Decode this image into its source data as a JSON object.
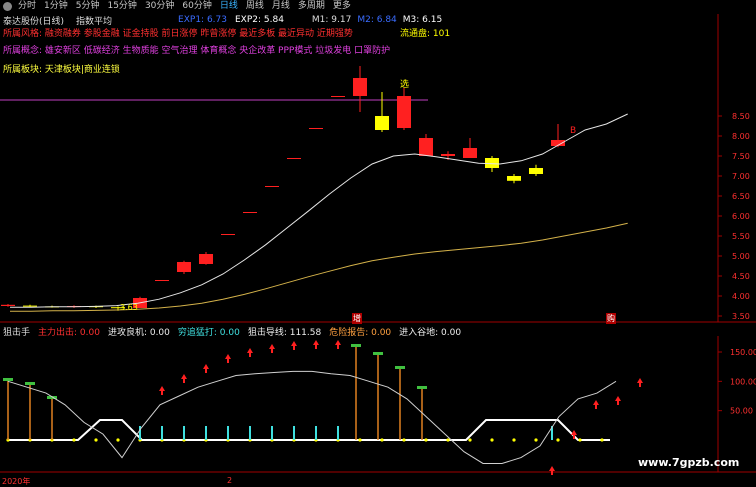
{
  "tabs": [
    {
      "label": "分时",
      "active": false
    },
    {
      "label": "1分钟",
      "active": false
    },
    {
      "label": "5分钟",
      "active": false
    },
    {
      "label": "15分钟",
      "active": false
    },
    {
      "label": "30分钟",
      "active": false
    },
    {
      "label": "60分钟",
      "active": false
    },
    {
      "label": "日线",
      "active": true
    },
    {
      "label": "周线",
      "active": false
    },
    {
      "label": "月线",
      "active": false
    },
    {
      "label": "多周期",
      "active": false
    },
    {
      "label": "更多",
      "active": false
    }
  ],
  "title": {
    "stock": "泰达股份(日线)",
    "indicator": "指数平均",
    "exp1": "EXP1: 6.73",
    "exp2": "EXP2: 5.84",
    "m1": "M1: 9.17",
    "m2": "M2: 6.84",
    "m3": "M3: 6.15"
  },
  "info": {
    "risk": "所属风格: 融资融券 参股金融 证金持股 前日涨停 昨曾涨停 最近多板 最近异动 近期强势",
    "concept": "所属概念: 雄安新区 低碳经济 生物质能 空气治理 体育概念 央企改革 PPP模式 垃圾发电 口罩防护",
    "board": "所属板块: 天津板块|商业连锁",
    "market_cap": "流通盘: 101"
  },
  "price_axis": [
    "8.50",
    "8.00",
    "7.50",
    "7.00",
    "6.50",
    "6.00",
    "5.50",
    "5.00",
    "4.50",
    "4.00",
    "3.50"
  ],
  "annotations": {
    "select": "选",
    "buy_b": "B",
    "low_price": "3.63",
    "zeng": "增",
    "gou": "购"
  },
  "sub_indicator": {
    "name": "狙击手",
    "l1": "主力出击: 0.00",
    "l2": "进攻良机: 0.00",
    "l3": "穷追猛打: 0.00",
    "l4": "狙击导线: 111.58",
    "l5": "危险报告: 0.00",
    "l6": "进入谷地: 0.00"
  },
  "sub_axis": [
    "150.00",
    "100.00",
    "50.00"
  ],
  "bottom": {
    "year": "2020年",
    "tick": "2"
  },
  "watermark": "www.7gpzb.com",
  "colors": {
    "up": "#ff2020",
    "down": "#ffff00",
    "ma1": "#e6e6e6",
    "ma2": "#d4b24a",
    "purple": "#c040c0"
  },
  "chart_data": {
    "type": "candlestick",
    "candles": [
      {
        "o": 3.75,
        "c": 3.78,
        "h": 3.8,
        "l": 3.73
      },
      {
        "o": 3.76,
        "c": 3.74,
        "h": 3.78,
        "l": 3.72
      },
      {
        "o": 3.74,
        "c": 3.73,
        "h": 3.76,
        "l": 3.71
      },
      {
        "o": 3.73,
        "c": 3.75,
        "h": 3.77,
        "l": 3.7
      },
      {
        "o": 3.75,
        "c": 3.72,
        "h": 3.76,
        "l": 3.7
      },
      {
        "o": 3.72,
        "c": 3.7,
        "h": 3.74,
        "l": 3.63
      },
      {
        "o": 3.7,
        "c": 3.95,
        "h": 3.98,
        "l": 3.7
      },
      {
        "o": 4.4,
        "c": 4.4,
        "h": 4.4,
        "l": 4.4
      },
      {
        "o": 4.6,
        "c": 4.85,
        "h": 4.88,
        "l": 4.55
      },
      {
        "o": 4.8,
        "c": 5.05,
        "h": 5.1,
        "l": 4.78
      },
      {
        "o": 5.55,
        "c": 5.55,
        "h": 5.55,
        "l": 5.55
      },
      {
        "o": 6.1,
        "c": 6.1,
        "h": 6.1,
        "l": 6.1
      },
      {
        "o": 6.75,
        "c": 6.75,
        "h": 6.75,
        "l": 6.75
      },
      {
        "o": 7.45,
        "c": 7.45,
        "h": 7.45,
        "l": 7.45
      },
      {
        "o": 8.2,
        "c": 8.2,
        "h": 8.2,
        "l": 8.2
      },
      {
        "o": 9.0,
        "c": 9.0,
        "h": 9.0,
        "l": 9.0
      },
      {
        "o": 9.0,
        "c": 9.45,
        "h": 9.75,
        "l": 8.6
      },
      {
        "o": 8.5,
        "c": 8.15,
        "h": 9.1,
        "l": 8.1
      },
      {
        "o": 8.2,
        "c": 9.0,
        "h": 9.2,
        "l": 8.15
      },
      {
        "o": 7.5,
        "c": 7.95,
        "h": 8.05,
        "l": 7.5
      },
      {
        "o": 7.5,
        "c": 7.55,
        "h": 7.62,
        "l": 7.4
      },
      {
        "o": 7.45,
        "c": 7.7,
        "h": 7.95,
        "l": 7.45
      },
      {
        "o": 7.45,
        "c": 7.2,
        "h": 7.5,
        "l": 7.1
      },
      {
        "o": 7.0,
        "c": 6.88,
        "h": 7.05,
        "l": 6.82
      },
      {
        "o": 7.2,
        "c": 7.05,
        "h": 7.28,
        "l": 7.0
      },
      {
        "o": 7.75,
        "c": 7.9,
        "h": 8.3,
        "l": 7.72
      }
    ],
    "ma1": [
      3.72,
      3.72,
      3.73,
      3.73,
      3.74,
      3.76,
      3.82,
      3.92,
      4.08,
      4.28,
      4.55,
      4.9,
      5.28,
      5.7,
      6.12,
      6.55,
      6.95,
      7.3,
      7.5,
      7.55,
      7.48,
      7.4,
      7.32,
      7.3,
      7.38,
      7.55,
      7.85,
      8.15,
      8.3,
      8.55
    ],
    "ma2": [
      3.62,
      3.62,
      3.63,
      3.63,
      3.64,
      3.65,
      3.67,
      3.7,
      3.75,
      3.82,
      3.92,
      4.04,
      4.18,
      4.33,
      4.48,
      4.62,
      4.76,
      4.88,
      4.97,
      5.05,
      5.11,
      5.16,
      5.21,
      5.26,
      5.32,
      5.4,
      5.5,
      5.6,
      5.7,
      5.82
    ],
    "ylim": [
      3.5,
      8.5
    ],
    "sub_line": [
      100,
      90,
      80,
      60,
      30,
      10,
      -30,
      20,
      60,
      75,
      90,
      100,
      110,
      113,
      115,
      117,
      117,
      113,
      110,
      100,
      90,
      70,
      40,
      10,
      -20,
      -40,
      -40,
      -30,
      -10,
      40,
      70,
      80,
      100
    ]
  }
}
